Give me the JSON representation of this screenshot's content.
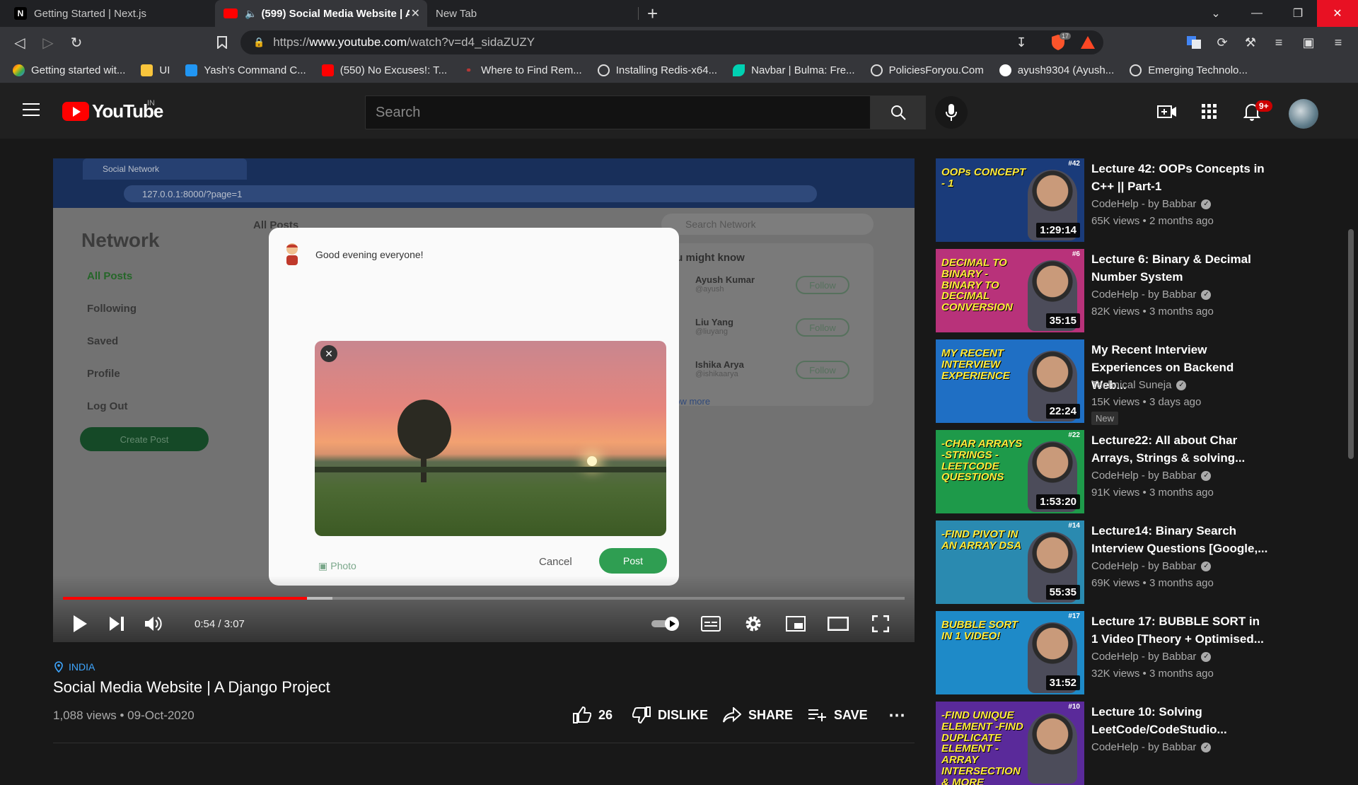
{
  "browser": {
    "tabs": [
      {
        "title": "Getting Started | Next.js",
        "favicon": "N"
      },
      {
        "title": "(599) Social Media Website | A",
        "favicon": "yt"
      },
      {
        "title": "New Tab",
        "favicon": ""
      }
    ],
    "url_scheme": "https://",
    "url_host": "www.youtube.com",
    "url_path": "/watch?v=d4_sidaZUZY",
    "brave_shield_count": "17",
    "bookmarks": [
      "Getting started wit...",
      "UI",
      "Yash's Command C...",
      "(550) No Excuses!: T...",
      "Where to Find Rem...",
      "Installing Redis-x64...",
      "Navbar | Bulma: Fre...",
      "PoliciesForyou.Com",
      "ayush9304 (Ayush...",
      "Emerging Technolo..."
    ]
  },
  "youtube": {
    "logo_text": "YouTube",
    "region": "IN",
    "search_placeholder": "Search",
    "notification_count": "9+",
    "accent": "#ff0000"
  },
  "video_content": {
    "tab_title": "Social Network",
    "url": "127.0.0.1:8000/?page=1",
    "brand": "Network",
    "sidebar": [
      "All Posts",
      "Following",
      "Saved",
      "Profile",
      "Log Out"
    ],
    "create_post": "Create Post",
    "all_posts_heading": "All Posts",
    "search_network": "Search Network",
    "people_heading": "ou might know",
    "people": [
      {
        "name": "Ayush Kumar",
        "handle": "@ayush"
      },
      {
        "name": "Liu Yang",
        "handle": "@liuyang"
      },
      {
        "name": "Ishika Arya",
        "handle": "@ishikaarya"
      }
    ],
    "follow_label": "Follow",
    "show_more": "how more",
    "modal_text": "Good evening everyone!",
    "photo_label": "Photo",
    "cancel_label": "Cancel",
    "post_label": "Post"
  },
  "player": {
    "time": "0:54 / 3:07",
    "progress": 0.29,
    "buffered": 0.32
  },
  "video": {
    "location": "INDIA",
    "title": "Social Media Website | A Django Project",
    "meta": "1,088 views • 09-Oct-2020",
    "likes": "26",
    "dislike_label": "DISLIKE",
    "share_label": "SHARE",
    "save_label": "SAVE"
  },
  "recommendations": [
    {
      "title": "Lecture 42: OOPs Concepts in C++ || Part-1",
      "channel": "CodeHelp - by Babbar",
      "views": "65K views • 2 months ago",
      "duration": "1:29:14",
      "thumb_text": "OOPs CONCEPT - 1",
      "thumb_num": "#42",
      "thumb_bg": "#1a3b7a",
      "badge": ""
    },
    {
      "title": "Lecture 6: Binary & Decimal Number System",
      "channel": "CodeHelp - by Babbar",
      "views": "82K views • 3 months ago",
      "duration": "35:15",
      "thumb_text": "DECIMAL TO BINARY -BINARY TO DECIMAL CONVERSION",
      "thumb_num": "#6",
      "thumb_bg": "#b8327a",
      "badge": ""
    },
    {
      "title": "My Recent Interview Experiences on Backend Web...",
      "channel": "Technical Suneja",
      "views": "15K views • 3 days ago",
      "duration": "22:24",
      "thumb_text": "MY RECENT INTERVIEW EXPERIENCE",
      "thumb_num": "",
      "thumb_bg": "#1f6fc4",
      "badge": "New"
    },
    {
      "title": "Lecture22: All about Char Arrays, Strings & solving...",
      "channel": "CodeHelp - by Babbar",
      "views": "91K views • 3 months ago",
      "duration": "1:53:20",
      "thumb_text": "-CHAR ARRAYS -STRINGS -LEETCODE QUESTIONS",
      "thumb_num": "#22",
      "thumb_bg": "#1e9a4a",
      "badge": ""
    },
    {
      "title": "Lecture14: Binary Search Interview Questions [Google,...",
      "channel": "CodeHelp - by Babbar",
      "views": "69K views • 3 months ago",
      "duration": "55:35",
      "thumb_text": "-FIND PIVOT IN AN ARRAY DSA",
      "thumb_num": "#14",
      "thumb_bg": "#2a8ab0",
      "badge": ""
    },
    {
      "title": "Lecture 17: BUBBLE SORT in 1 Video [Theory + Optimised...",
      "channel": "CodeHelp - by Babbar",
      "views": "32K views • 3 months ago",
      "duration": "31:52",
      "thumb_text": "BUBBLE SORT IN 1 VIDEO!",
      "thumb_num": "#17",
      "thumb_bg": "#1e8ac8",
      "badge": ""
    },
    {
      "title": "Lecture 10: Solving LeetCode/CodeStudio...",
      "channel": "CodeHelp - by Babbar",
      "views": "",
      "duration": "",
      "thumb_text": "-FIND UNIQUE ELEMENT -FIND DUPLICATE ELEMENT -ARRAY INTERSECTION & MORE",
      "thumb_num": "#10",
      "thumb_bg": "#5a2a9a",
      "badge": ""
    }
  ]
}
